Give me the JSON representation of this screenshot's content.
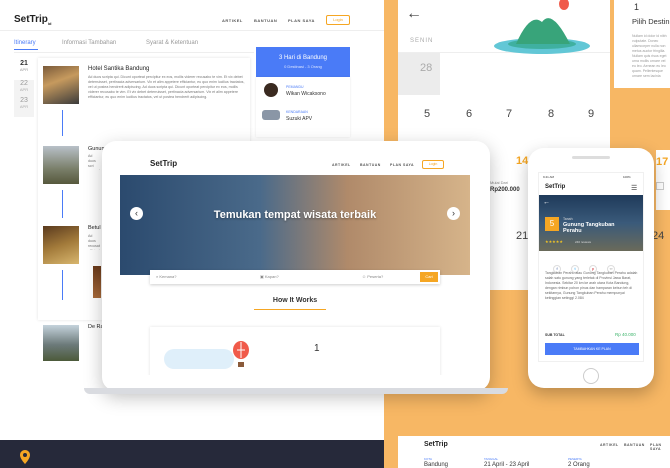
{
  "top_nav": {
    "logo": "SetTrip",
    "logo_suffix": "id",
    "links": [
      "ARTIKEL",
      "BANTUAN",
      "PLAN SAYA"
    ],
    "login": "Login"
  },
  "itinerary": {
    "tabs": [
      "Itinerary",
      "Informasi Tambahan",
      "Syarat & Ketentuan"
    ],
    "dates": [
      {
        "day": "21",
        "month": "APR"
      },
      {
        "day": "22",
        "month": "APR"
      },
      {
        "day": "23",
        "month": "APR"
      }
    ],
    "items": [
      {
        "title": "Hotel Santika Bandung",
        "desc": "Ad duos scripta qui. Dicunt oporteat percipitur ex eos, mollis viderer recusabo te vim. Et vix debet deterruisset, pertinacia adversarium. Vix et alim appetere efficiantur, eu quo enim lucilius tractatos, vel ut postea hendrerit adipiscing. Ad duos scripta qui. Dicunt oporteat percipitur ex eos, mollis viderer recusabo te vim. Et vix debet deterruisset, pertinacia adversarium. Vix et alim appetere efficiantur, eu quo enim lucilius tractatos, vel ut postea hendrerit adipiscing."
      },
      {
        "title": "Gunung",
        "desc": "Ad duos scri recusabo te efficiantur"
      },
      {
        "title": "Betul",
        "desc": "Ad duos recusabo efficiantur"
      },
      {
        "title": "De Ra",
        "desc": "Ad duos scri recusabo te efficiantur"
      }
    ],
    "summary": {
      "title": "3 Hari di Bandung",
      "subtitle": "0 Destinasi - 3 Orang",
      "guide_label": "PEMANDU",
      "guide_name": "Wikan Wicaksono",
      "vehicle_label": "KENDARAAN",
      "vehicle_name": "Suzuki APV"
    }
  },
  "calendar": {
    "weekday": "SENIN",
    "rows": [
      [
        "28",
        "",
        "",
        ""
      ],
      [
        "5",
        "6",
        "7",
        "8",
        "9"
      ],
      [
        "14",
        "",
        "",
        "",
        "17"
      ],
      [
        "",
        "",
        "21",
        "",
        "24"
      ]
    ],
    "price_label": "Mulai Dari",
    "price": "Rp200.000",
    "right_title": "Pilih Destin",
    "right_text": "Nullam id dolor id nibh vulputate. Donec ullamcorper nulla non metus auctor fringilla. Nullam quis risus eget urna mollis ornare vel eu leo. Aenean eu leo quam. Pellentesque ornare sem lacinia quam venenatis vestibulum. Maecenas sed diam eget risus varius blandit sit amet non magna. Etiam porta sem malesuada magna mollis euismod."
  },
  "tablet": {
    "hero_title": "Temukan tempat wisata terbaik",
    "search_where": "Kemana?",
    "search_when": "Kapan?",
    "search_who": "Peserta?",
    "search_button": "Cari",
    "section_title": "How It Works",
    "step_number": "1"
  },
  "phone": {
    "status_time": "9:41 AM",
    "status_battery": "100%",
    "dest_number": "5",
    "dest_label": "Tanah",
    "dest_name": "Gunung Tangkuban Perahu",
    "reviews": "240 reviews",
    "desc": "Tangkuban Perahu atau Gunung Tangkuban Perahu adalah salah satu gunung yang terletak di Provinsi Jawa Barat, Indonesia. Sekitar 20 km ke arah utara Kota Bandung, dengan rimbun pohon pinus dan hamparan kebun teh di sekitarnya, Gunung Tangkuban Perahu mempunyai ketinggian setinggi 2.084",
    "subtotal_label": "SUB TOTAL",
    "subtotal_value": "Rp 40.000",
    "cta": "TAMBAHKAN KE PLAN"
  },
  "bottom_bar": {
    "cols": [
      {
        "label": "KOTA",
        "value": "Bandung"
      },
      {
        "label": "TANGGAL",
        "value": "21 April - 23 April"
      },
      {
        "label": "PESERTA",
        "value": "2 Orang"
      }
    ]
  },
  "colors": {
    "accent": "#4a7bf7",
    "orange": "#f5a623",
    "bg_orange": "#f7b764",
    "dark": "#26293a"
  }
}
